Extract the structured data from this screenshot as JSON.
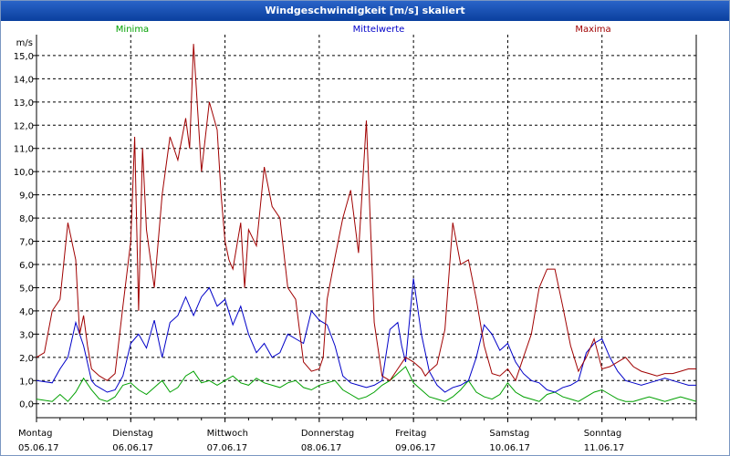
{
  "window": {
    "title": "Windgeschwindigkeit [m/s] skaliert"
  },
  "chart_data": {
    "type": "line",
    "title": "Windgeschwindigkeit [m/s] skaliert",
    "ylabel": "m/s",
    "ylim": [
      -0.6,
      15.9
    ],
    "xlim": [
      0,
      168
    ],
    "grid": true,
    "legend": "top",
    "y_ticks": [
      "0,0",
      "1,0",
      "2,0",
      "3,0",
      "4,0",
      "5,0",
      "6,0",
      "7,0",
      "8,0",
      "9,0",
      "10,0",
      "11,0",
      "12,0",
      "13,0",
      "14,0",
      "15,0"
    ],
    "x_ticks": [
      {
        "day": "Montag",
        "date": "05.06.17"
      },
      {
        "day": "Dienstag",
        "date": "06.06.17"
      },
      {
        "day": "Mittwoch",
        "date": "07.06.17"
      },
      {
        "day": "Donnerstag",
        "date": "08.06.17"
      },
      {
        "day": "Freitag",
        "date": "09.06.17"
      },
      {
        "day": "Samstag",
        "date": "10.06.17"
      },
      {
        "day": "Sonntag",
        "date": "11.06.17"
      }
    ],
    "series": [
      {
        "name": "Minima",
        "color": "#00a000",
        "x": [
          0,
          4,
          6,
          8,
          10,
          12,
          14,
          16,
          18,
          20,
          22,
          24,
          26,
          28,
          30,
          32,
          34,
          36,
          38,
          40,
          42,
          44,
          46,
          48,
          50,
          52,
          54,
          56,
          58,
          60,
          62,
          64,
          66,
          68,
          70,
          72,
          74,
          76,
          78,
          80,
          82,
          84,
          86,
          88,
          90,
          92,
          94,
          96,
          98,
          100,
          102,
          104,
          106,
          108,
          110,
          112,
          114,
          116,
          118,
          120,
          122,
          124,
          126,
          128,
          130,
          132,
          134,
          136,
          138,
          140,
          142,
          144,
          146,
          148,
          150,
          152,
          154,
          156,
          158,
          160,
          162,
          164,
          166,
          168
        ],
        "y": [
          0.2,
          0.1,
          0.4,
          0.1,
          0.5,
          1.1,
          0.6,
          0.2,
          0.1,
          0.3,
          0.8,
          0.9,
          0.6,
          0.4,
          0.7,
          1.0,
          0.5,
          0.7,
          1.2,
          1.4,
          0.9,
          1.0,
          0.8,
          1.0,
          1.2,
          0.9,
          0.8,
          1.1,
          0.9,
          0.8,
          0.7,
          0.9,
          1.0,
          0.7,
          0.6,
          0.8,
          0.9,
          1.0,
          0.6,
          0.4,
          0.2,
          0.3,
          0.5,
          0.8,
          1.0,
          1.3,
          1.6,
          0.9,
          0.6,
          0.3,
          0.2,
          0.1,
          0.3,
          0.6,
          1.0,
          0.5,
          0.3,
          0.2,
          0.4,
          0.9,
          0.5,
          0.3,
          0.2,
          0.1,
          0.4,
          0.5,
          0.3,
          0.2,
          0.1,
          0.3,
          0.5,
          0.6,
          0.4,
          0.2,
          0.1,
          0.1,
          0.2,
          0.3,
          0.2,
          0.1,
          0.2,
          0.3,
          0.2,
          0.1
        ]
      },
      {
        "name": "Mittelwerte",
        "color": "#0000c8",
        "x": [
          0,
          4,
          6,
          8,
          10,
          12,
          14,
          15,
          16,
          18,
          20,
          22,
          24,
          26,
          28,
          30,
          32,
          34,
          36,
          38,
          40,
          42,
          44,
          46,
          48,
          50,
          52,
          54,
          56,
          58,
          60,
          62,
          64,
          66,
          68,
          70,
          72,
          74,
          76,
          78,
          80,
          82,
          84,
          86,
          88,
          90,
          92,
          93,
          94,
          96,
          98,
          100,
          102,
          104,
          106,
          108,
          110,
          112,
          114,
          116,
          118,
          120,
          122,
          124,
          126,
          128,
          130,
          132,
          134,
          136,
          138,
          140,
          142,
          144,
          146,
          148,
          150,
          152,
          154,
          156,
          158,
          160,
          162,
          164,
          166,
          168
        ],
        "y": [
          1.0,
          0.9,
          1.5,
          2.0,
          3.5,
          2.5,
          1.0,
          0.8,
          0.7,
          0.5,
          0.6,
          1.2,
          2.6,
          3.0,
          2.4,
          3.6,
          2.0,
          3.5,
          3.8,
          4.6,
          3.8,
          4.6,
          5.0,
          4.2,
          4.5,
          3.4,
          4.2,
          3.0,
          2.2,
          2.6,
          2.0,
          2.2,
          3.0,
          2.8,
          2.6,
          4.0,
          3.6,
          3.4,
          2.5,
          1.2,
          0.9,
          0.8,
          0.7,
          0.8,
          1.0,
          3.2,
          3.5,
          2.5,
          1.8,
          5.4,
          3.0,
          1.4,
          0.8,
          0.5,
          0.7,
          0.8,
          1.0,
          2.0,
          3.4,
          3.0,
          2.3,
          2.6,
          1.8,
          1.3,
          1.0,
          0.9,
          0.6,
          0.5,
          0.7,
          0.8,
          1.0,
          2.2,
          2.6,
          2.8,
          2.0,
          1.4,
          1.0,
          0.9,
          0.8,
          0.9,
          1.0,
          1.1,
          1.0,
          0.9,
          0.8,
          0.8
        ]
      },
      {
        "name": "Maxima",
        "color": "#a00000",
        "x": [
          0,
          2,
          4,
          6,
          8,
          10,
          11,
          12,
          13,
          14,
          16,
          18,
          20,
          22,
          24,
          25,
          26,
          27,
          28,
          30,
          32,
          34,
          36,
          38,
          39,
          40,
          42,
          44,
          46,
          47,
          48,
          49,
          50,
          52,
          53,
          54,
          56,
          58,
          60,
          62,
          64,
          66,
          68,
          70,
          72,
          73,
          74,
          76,
          78,
          80,
          82,
          84,
          86,
          88,
          90,
          92,
          94,
          96,
          98,
          99,
          100,
          102,
          104,
          106,
          108,
          110,
          112,
          114,
          116,
          118,
          120,
          122,
          124,
          126,
          128,
          130,
          132,
          134,
          136,
          138,
          140,
          142,
          144,
          146,
          148,
          150,
          152,
          154,
          156,
          158,
          160,
          162,
          164,
          166,
          168
        ],
        "y": [
          2.0,
          2.2,
          4.0,
          4.5,
          7.8,
          6.2,
          3.0,
          3.8,
          2.5,
          1.5,
          1.2,
          1.0,
          1.3,
          4.2,
          7.0,
          11.5,
          4.0,
          11.0,
          7.5,
          5.0,
          9.0,
          11.5,
          10.5,
          12.3,
          11.0,
          15.5,
          10.0,
          13.0,
          11.8,
          9.0,
          7.0,
          6.2,
          5.8,
          7.8,
          5.0,
          7.5,
          6.8,
          10.2,
          8.5,
          8.0,
          5.0,
          4.5,
          1.8,
          1.4,
          1.5,
          2.0,
          4.5,
          6.3,
          8.0,
          9.2,
          6.5,
          12.2,
          3.5,
          1.2,
          1.0,
          1.5,
          2.0,
          1.8,
          1.5,
          1.2,
          1.4,
          1.7,
          3.2,
          7.8,
          6.0,
          6.2,
          4.5,
          2.5,
          1.3,
          1.2,
          1.5,
          1.0,
          2.0,
          3.0,
          5.0,
          5.8,
          5.8,
          4.2,
          2.5,
          1.4,
          2.0,
          2.8,
          1.5,
          1.6,
          1.8,
          2.0,
          1.6,
          1.4,
          1.3,
          1.2,
          1.3,
          1.3,
          1.4,
          1.5,
          1.5
        ]
      }
    ]
  }
}
